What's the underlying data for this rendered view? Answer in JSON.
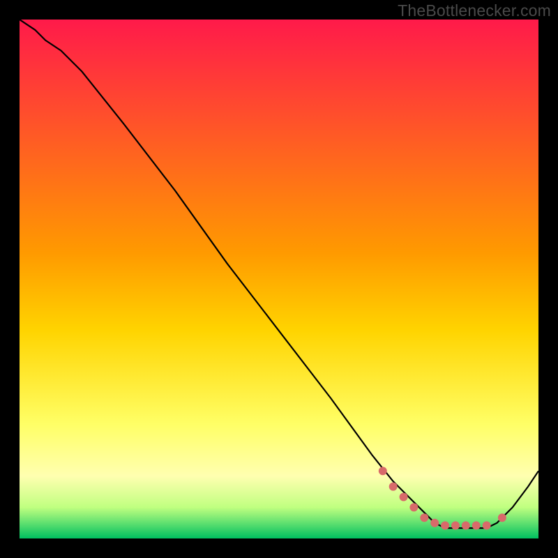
{
  "watermark": "TheBottlenecker.com",
  "colors": {
    "frame_bg": "#000000",
    "grad_top": "#ff1a4a",
    "grad_mid": "#ffd400",
    "grad_yellowpale": "#ffff99",
    "grad_green": "#00d060",
    "curve": "#000000",
    "dot": "#d86a6a"
  },
  "chart_data": {
    "type": "line",
    "title": "",
    "xlabel": "",
    "ylabel": "",
    "xlim": [
      0,
      100
    ],
    "ylim": [
      0,
      100
    ],
    "series": [
      {
        "name": "curve",
        "x": [
          0,
          3,
          5,
          8,
          12,
          20,
          30,
          40,
          50,
          60,
          68,
          72,
          75,
          78,
          80,
          82,
          84,
          86,
          88,
          90,
          92,
          95,
          98,
          100
        ],
        "y": [
          100,
          98,
          96,
          94,
          90,
          80,
          67,
          53,
          40,
          27,
          16,
          11,
          8,
          5,
          3,
          2,
          2,
          2,
          2,
          2,
          3,
          6,
          10,
          13
        ]
      }
    ],
    "dots": {
      "name": "highlight-points",
      "x": [
        70,
        72,
        74,
        76,
        78,
        80,
        82,
        84,
        86,
        88,
        90,
        93
      ],
      "y": [
        13,
        10,
        8,
        6,
        4,
        3,
        2.5,
        2.5,
        2.5,
        2.5,
        2.5,
        4
      ]
    },
    "gradient_stops": [
      {
        "offset": 0.0,
        "color": "#ff1a4a"
      },
      {
        "offset": 0.45,
        "color": "#ff9a00"
      },
      {
        "offset": 0.6,
        "color": "#ffd400"
      },
      {
        "offset": 0.78,
        "color": "#ffff66"
      },
      {
        "offset": 0.88,
        "color": "#ffffb0"
      },
      {
        "offset": 0.94,
        "color": "#c0ff80"
      },
      {
        "offset": 0.97,
        "color": "#60e070"
      },
      {
        "offset": 1.0,
        "color": "#00c060"
      }
    ]
  }
}
